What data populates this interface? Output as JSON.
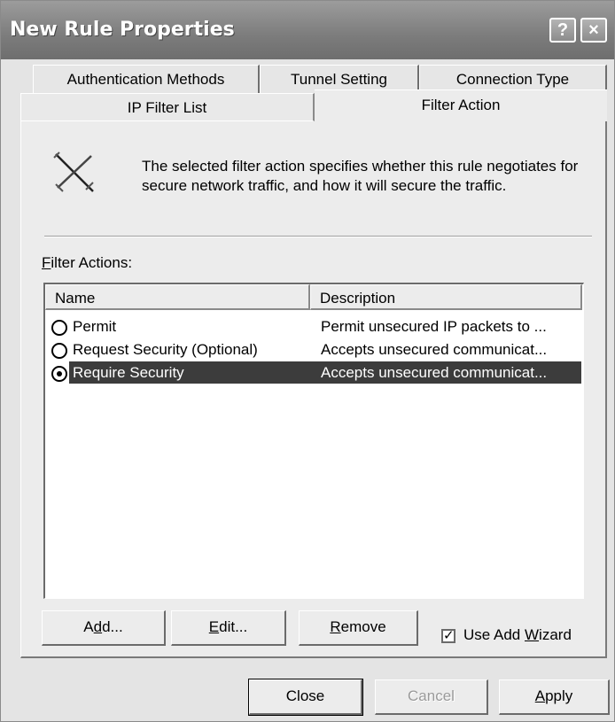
{
  "window": {
    "title": "New Rule Properties",
    "help_button": "?",
    "close_button": "×"
  },
  "tabs": {
    "row1": [
      "Authentication Methods",
      "Tunnel Setting",
      "Connection Type"
    ],
    "row2": [
      "IP Filter List",
      "Filter Action"
    ],
    "selected": "Filter Action"
  },
  "info": {
    "icon": "filter-action-icon",
    "text": "The selected filter action specifies whether this rule negotiates for secure network traffic, and how it will secure the traffic."
  },
  "filter_actions": {
    "label_mnemonic": "F",
    "label_rest": "ilter Actions:",
    "columns": [
      "Name",
      "Description"
    ],
    "rows": [
      {
        "name": "Permit",
        "description": "Permit unsecured IP packets to ...",
        "selected": false
      },
      {
        "name": "Request Security (Optional)",
        "description": "Accepts unsecured communicat...",
        "selected": false
      },
      {
        "name": "Require Security",
        "description": "Accepts unsecured communicat...",
        "selected": true
      }
    ]
  },
  "buttons": {
    "add_pre": "A",
    "add_mn": "d",
    "add_post": "d...",
    "edit_mn": "E",
    "edit_post": "dit...",
    "remove_mn": "R",
    "remove_post": "emove",
    "wizard_check": "✓",
    "wizard_pre": "Use Add ",
    "wizard_mn": "W",
    "wizard_post": "izard",
    "close": "Close",
    "cancel": "Cancel",
    "apply_mn": "A",
    "apply_post": "pply"
  },
  "use_add_wizard_checked": true
}
